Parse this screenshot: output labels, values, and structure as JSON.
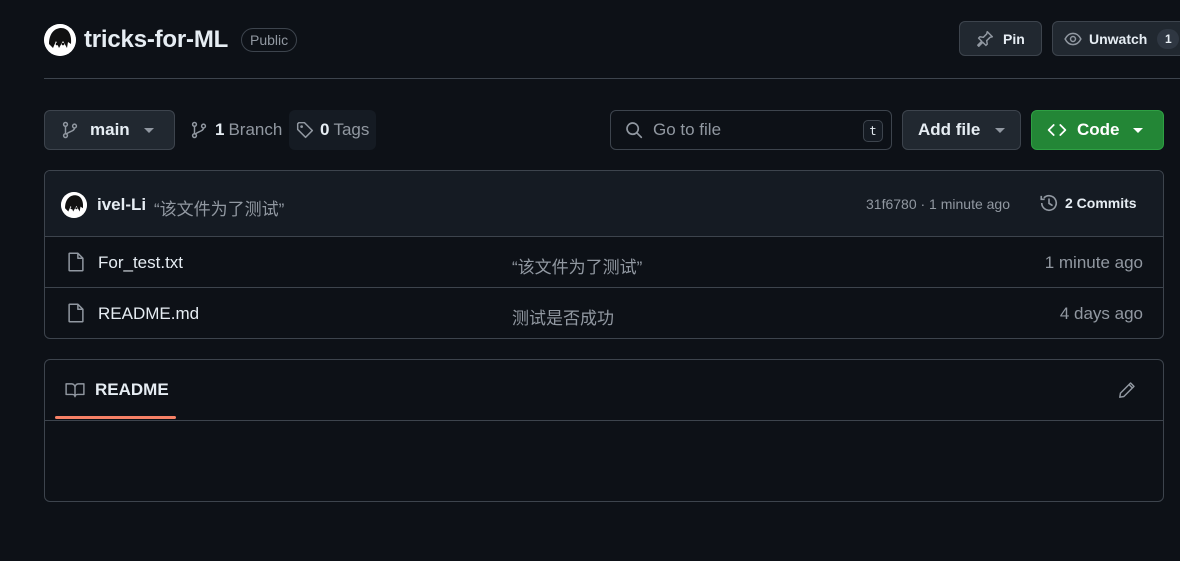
{
  "repo": {
    "name": "tricks-for-ML",
    "visibility": "Public"
  },
  "header_actions": {
    "pin_label": "Pin",
    "watch_label": "Unwatch",
    "watch_count": "1"
  },
  "toolbar": {
    "branch": "main",
    "branch_count": "1",
    "branch_label": "Branch",
    "tag_count": "0",
    "tag_label": "Tags",
    "search_placeholder": "Go to file",
    "search_shortcut": "t",
    "add_file_label": "Add file",
    "code_label": "Code"
  },
  "latest_commit": {
    "author": "ivel-Li",
    "message": "“该文件为了测试”",
    "hash_time": "31f6780 · 1 minute ago",
    "commits_label": "2 Commits"
  },
  "files": [
    {
      "name": "For_test.txt",
      "commit": "“该文件为了测试”",
      "time": "1 minute ago"
    },
    {
      "name": "README.md",
      "commit": "测试是否成功",
      "time": "4 days ago"
    }
  ],
  "readme": {
    "tab_label": "README"
  },
  "icons": {
    "avatar": "avatar-image",
    "pin": "pin-icon",
    "watch": "eye-icon",
    "branch": "git-branch-icon",
    "tag": "tag-icon",
    "search": "search-icon",
    "code": "code-icon",
    "history": "history-icon",
    "file": "file-icon",
    "book": "book-icon",
    "edit": "pencil-icon"
  },
  "colors": {
    "background": "#0d1117",
    "border": "#3d444d",
    "code_button": "#238636",
    "tab_underline": "#f78166"
  }
}
